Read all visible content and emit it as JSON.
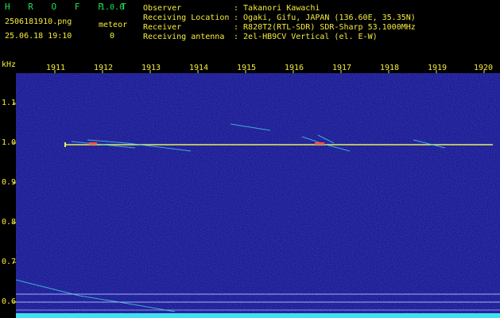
{
  "app": {
    "name": "H R O F F T",
    "version": "1.0.0",
    "filename": "2506181910.png",
    "datetime": "25.06.18 19:10",
    "meteor_label": "meteor",
    "meteor_count": "0"
  },
  "info": {
    "observer_label": "Observer",
    "observer_value": ": Takanori Kawachi",
    "location_label": "Receiving Location",
    "location_value": ": Ogaki, Gifu, JAPAN (136.60E, 35.35N)",
    "receiver_label": "Receiver",
    "receiver_value": ": R820T2(RTL-SDR) SDR-Sharp 53.1000MHz",
    "antenna_label": "Receiving antenna",
    "antenna_value": ": 2el-HB9CV Vertical (el. E-W)"
  },
  "axes": {
    "y_unit": "kHz",
    "y_ticks": [
      "1.1",
      "1.0",
      "0.9",
      "0.8",
      "0.7",
      "0.6"
    ],
    "x_ticks": [
      "1911",
      "1912",
      "1913",
      "1914",
      "1915",
      "1916",
      "1917",
      "1918",
      "1919",
      "1920"
    ]
  },
  "colors": {
    "background": "#1a1aa0",
    "header_green": "#22e052",
    "header_yellow": "#f5ec3a",
    "signal": "#e8f060"
  }
}
